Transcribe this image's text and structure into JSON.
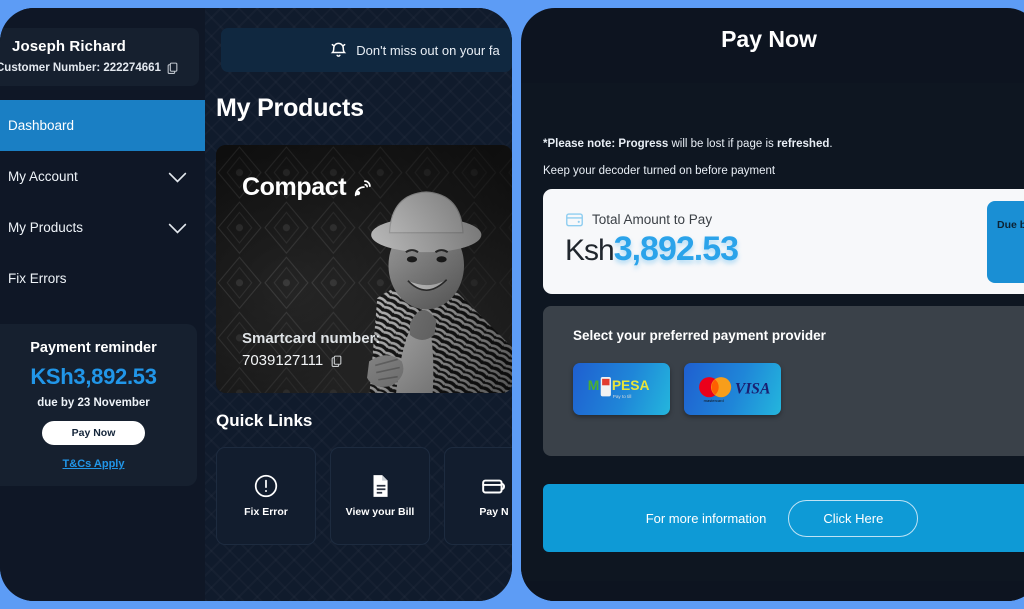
{
  "theme": {
    "page_background": "#5d9cf5",
    "accent_blue": "#1a7fc4",
    "amount_blue": "#2ba3ea",
    "panel_dark": "#0e1621",
    "card_light": "#f7f8fa"
  },
  "sidebar": {
    "user_name": "Joseph Richard",
    "customer_number_label": "Customer Number: 222274661",
    "copy_icon": "copy-icon",
    "items": [
      {
        "label": "Dashboard",
        "active": true,
        "has_chevron": false
      },
      {
        "label": "My Account",
        "active": false,
        "has_chevron": true
      },
      {
        "label": "My Products",
        "active": false,
        "has_chevron": true
      },
      {
        "label": "Fix Errors",
        "active": false,
        "has_chevron": false
      }
    ],
    "reminder": {
      "title": "Payment reminder",
      "amount": "KSh3,892.53",
      "due": "due by 23 November",
      "pay_button": "Pay Now",
      "terms_link": "T&Cs Apply"
    }
  },
  "main": {
    "notification": {
      "icon": "bell-icon",
      "text": "Don't miss out on your fa"
    },
    "page_title": "My Products",
    "product": {
      "brand": "Compact",
      "brand_icon": "satellite-dish-icon",
      "smartcard_label": "Smartcard number:",
      "smartcard_number": "7039127111",
      "copy_icon": "copy-icon"
    },
    "quick_links_title": "Quick Links",
    "quick_links": [
      {
        "label": "Fix Error",
        "icon": "alert-circle-icon"
      },
      {
        "label": "View your Bill",
        "icon": "document-icon"
      },
      {
        "label": "Pay N",
        "icon": "card-icon"
      }
    ]
  },
  "pay_panel": {
    "title": "Pay Now",
    "note_prefix": "*Please note: ",
    "note_bold_1": "Progress",
    "note_mid": " will be lost if page is ",
    "note_bold_2": "refreshed",
    "note_suffix": ".",
    "note_secondary": "Keep your decoder turned on before payment",
    "total": {
      "icon": "wallet-icon",
      "label": "Total Amount to Pay",
      "currency": "Ksh",
      "amount": "3,892.53",
      "due_badge": "Due by"
    },
    "provider": {
      "title": "Select your preferred payment provider",
      "options": [
        {
          "name": "mpesa",
          "label": "M-PESA"
        },
        {
          "name": "card",
          "label": "Mastercard VISA"
        }
      ]
    },
    "info_bar": {
      "text": "For more information",
      "button": "Click Here"
    }
  }
}
